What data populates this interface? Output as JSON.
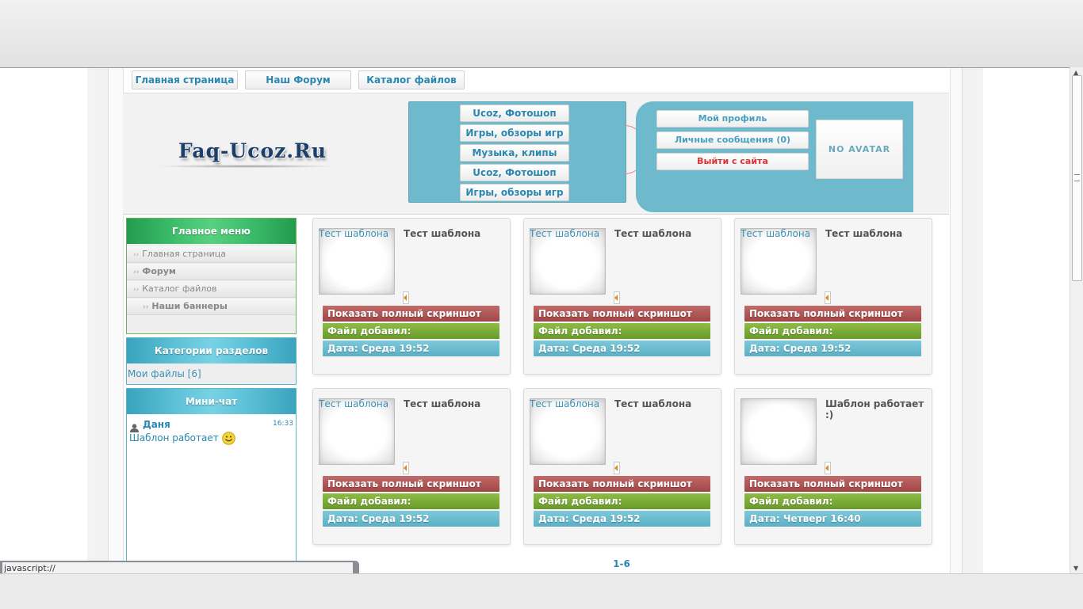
{
  "nav": {
    "home": "Главная страница",
    "forum": "Наш Форум",
    "catalog": "Каталог файлов"
  },
  "header": {
    "logo": "Faq-Ucoz.Ru",
    "categories": [
      "Ucoz, Фотошоп",
      "Игры, обзоры игр",
      "Музыка, клипы",
      "Ucoz, Фотошоп",
      "Игры, обзоры игр"
    ],
    "user_menu": {
      "profile": "Мой профиль",
      "messages": "Личные сообщения (0)",
      "logout": "Выйти с сайта",
      "avatar": "NO AVATAR"
    }
  },
  "sidebar": {
    "main_menu": {
      "title": "Главное меню",
      "items": [
        "Главная страница",
        "Форум",
        "Каталог файлов",
        "Наши баннеры"
      ]
    },
    "categories": {
      "title": "Категории разделов",
      "item": "Мои файлы [6]"
    },
    "minichat": {
      "title": "Мини-чат",
      "user": "Даня",
      "time": "16:33",
      "message": "Шаблон работает"
    }
  },
  "cards": [
    {
      "thumb_link": "Тест шаблона",
      "title": "Тест шаблона",
      "screenshot": "Показать полный скриншот",
      "added_by": "Файл добавил:",
      "date": "Дата: Среда 19:52"
    },
    {
      "thumb_link": "Тест шаблона",
      "title": "Тест шаблона",
      "screenshot": "Показать полный скриншот",
      "added_by": "Файл добавил:",
      "date": "Дата: Среда 19:52"
    },
    {
      "thumb_link": "Тест шаблона",
      "title": "Тест шаблона",
      "screenshot": "Показать полный скриншот",
      "added_by": "Файл добавил:",
      "date": "Дата: Среда 19:52"
    },
    {
      "thumb_link": "Тест шаблона",
      "title": "Тест шаблона",
      "screenshot": "Показать полный скриншот",
      "added_by": "Файл добавил:",
      "date": "Дата: Среда 19:52"
    },
    {
      "thumb_link": "Тест шаблона",
      "title": "Тест шаблона",
      "screenshot": "Показать полный скриншот",
      "added_by": "Файл добавил:",
      "date": "Дата: Среда 19:52"
    },
    {
      "thumb_link": "",
      "title": "Шаблон работает :)",
      "screenshot": "Показать полный скриншот",
      "added_by": "Файл добавил:",
      "date": "Дата: Четверг 16:40"
    }
  ],
  "pagination": "1-6",
  "status_bar": "javascript://"
}
